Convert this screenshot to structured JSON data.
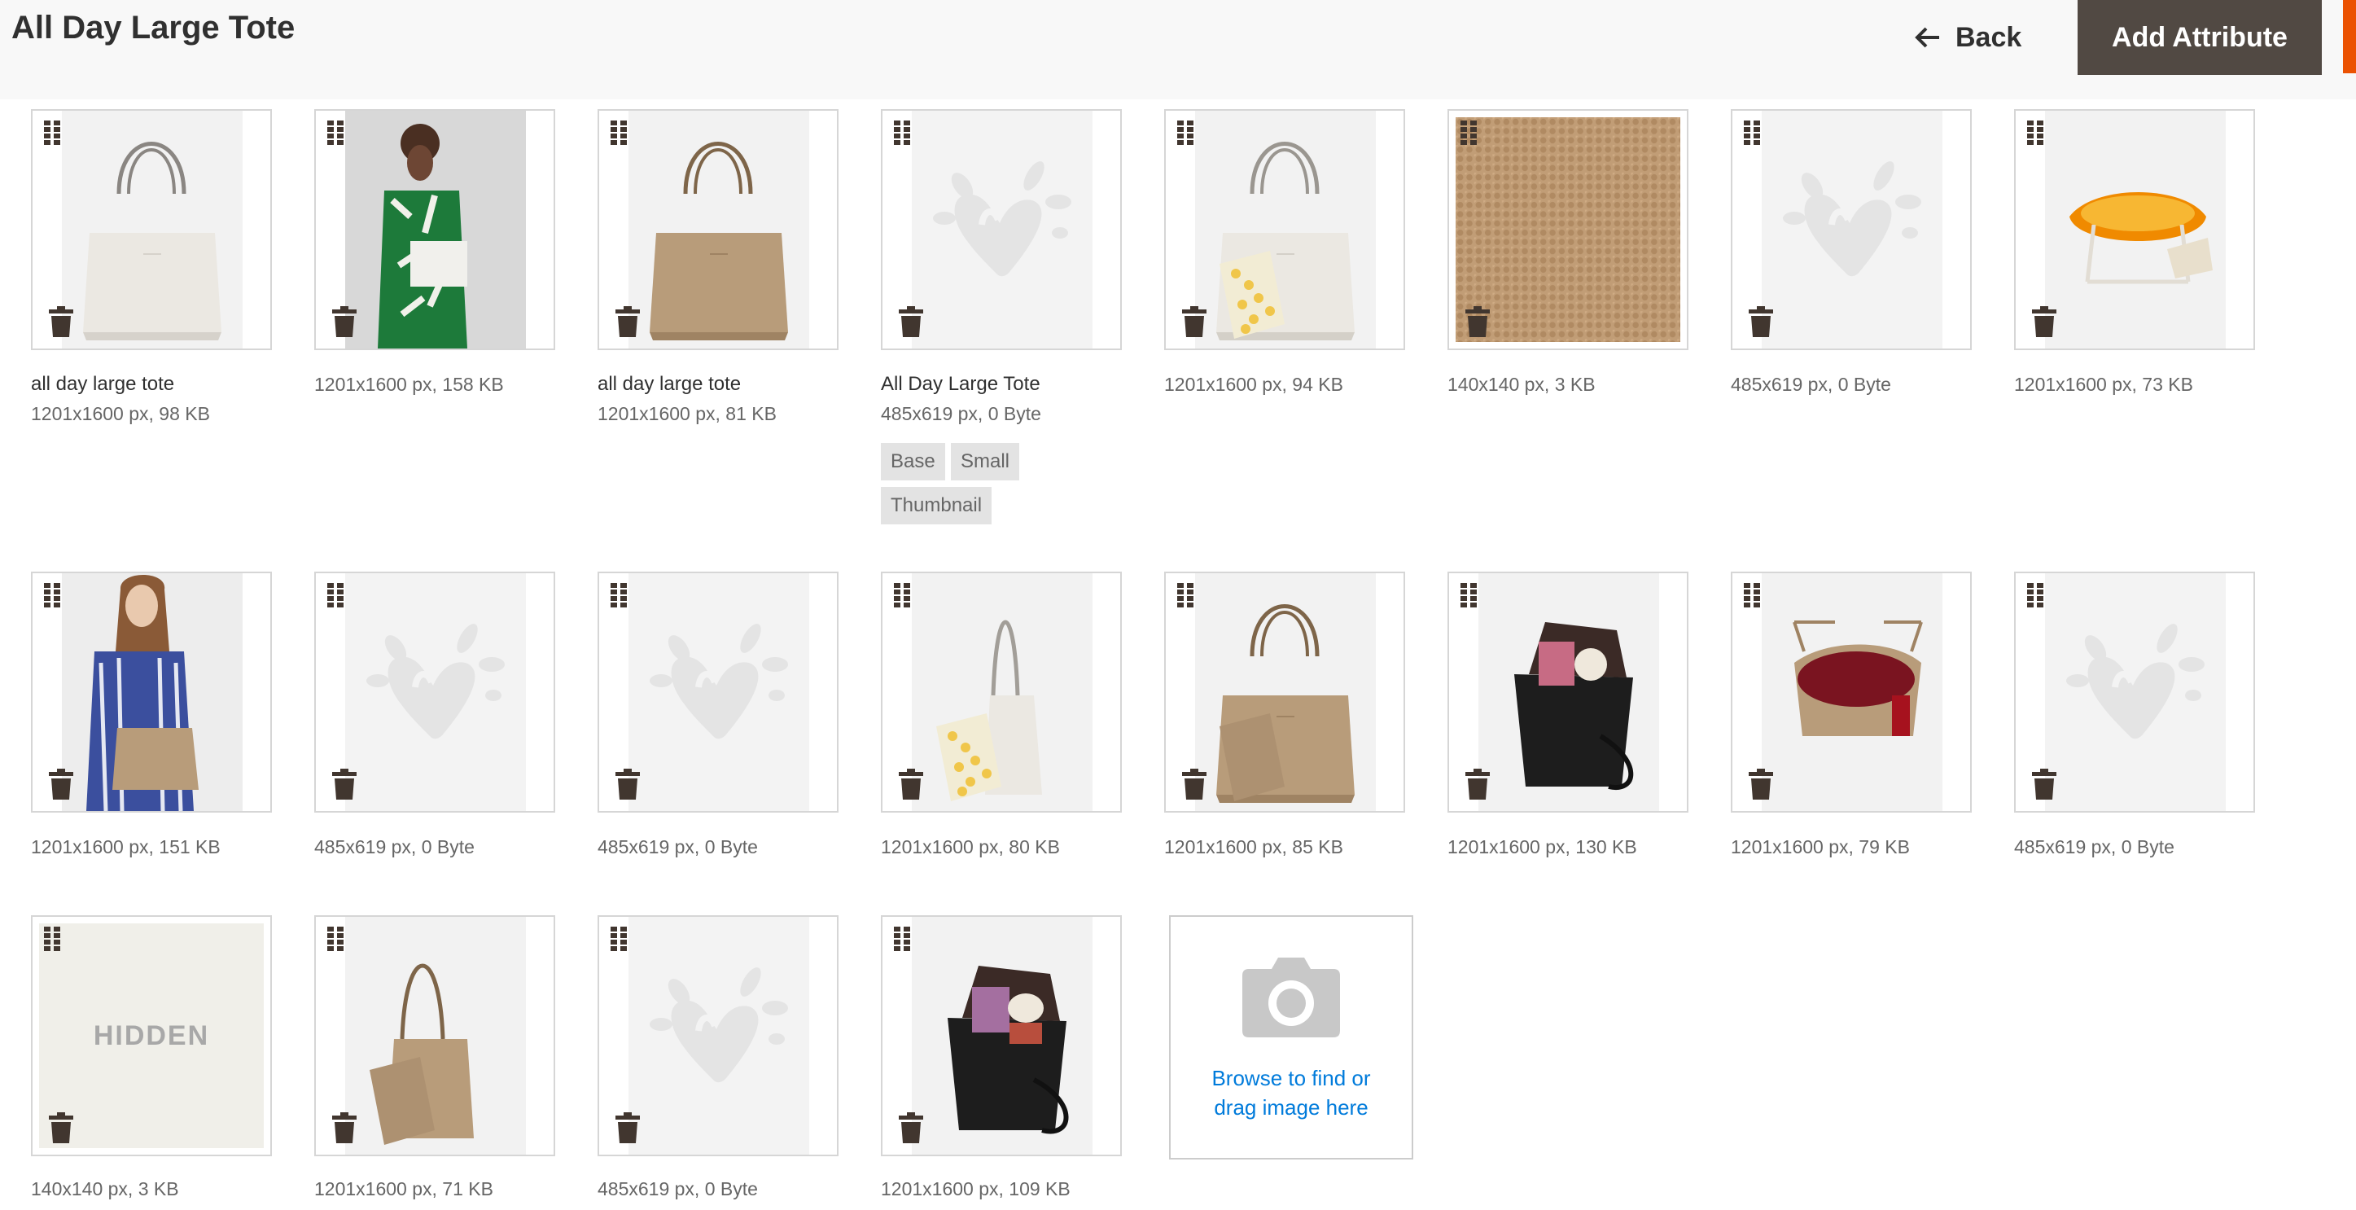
{
  "header": {
    "title": "All Day Large Tote",
    "back_label": "Back",
    "add_attribute_label": "Add Attribute"
  },
  "colors": {
    "accent": "#eb5202",
    "primary_button": "#514943",
    "link": "#007bdb"
  },
  "images": [
    {
      "caption": "all day large tote",
      "meta": "1201x1600 px, 98 KB",
      "thumb": "white-tote"
    },
    {
      "caption": "",
      "meta": "1201x1600 px, 158 KB",
      "thumb": "model-green-dress"
    },
    {
      "caption": "all day large tote",
      "meta": "1201x1600 px, 81 KB",
      "thumb": "tan-tote"
    },
    {
      "caption": "All Day Large Tote",
      "meta": "485x619 px, 0 Byte",
      "thumb": "placeholder",
      "roles": [
        "Base",
        "Small",
        "Thumbnail"
      ]
    },
    {
      "caption": "",
      "meta": "1201x1600 px, 94 KB",
      "thumb": "white-tote-pouch"
    },
    {
      "caption": "",
      "meta": "140x140 px, 3 KB",
      "thumb": "tan-leather-swatch"
    },
    {
      "caption": "",
      "meta": "485x619 px, 0 Byte",
      "thumb": "placeholder"
    },
    {
      "caption": "",
      "meta": "1201x1600 px, 73 KB",
      "thumb": "white-tote-open-orange"
    },
    {
      "caption": "",
      "meta": "1201x1600 px, 151 KB",
      "thumb": "model-blue-shirt"
    },
    {
      "caption": "",
      "meta": "485x619 px, 0 Byte",
      "thumb": "placeholder"
    },
    {
      "caption": "",
      "meta": "485x619 px, 0 Byte",
      "thumb": "placeholder"
    },
    {
      "caption": "",
      "meta": "1201x1600 px, 80 KB",
      "thumb": "white-tote-side-pouch"
    },
    {
      "caption": "",
      "meta": "1201x1600 px, 85 KB",
      "thumb": "tan-tote-pouch"
    },
    {
      "caption": "",
      "meta": "1201x1600 px, 130 KB",
      "thumb": "black-tote-open"
    },
    {
      "caption": "",
      "meta": "1201x1600 px, 79 KB",
      "thumb": "tan-tote-open-red"
    },
    {
      "caption": "",
      "meta": "485x619 px, 0 Byte",
      "thumb": "placeholder"
    },
    {
      "caption": "",
      "meta": "140x140 px, 3 KB",
      "thumb": "hidden-white-swatch",
      "overlay": "HIDDEN"
    },
    {
      "caption": "",
      "meta": "1201x1600 px, 71 KB",
      "thumb": "tan-tote-side-pouch"
    },
    {
      "caption": "",
      "meta": "485x619 px, 0 Byte",
      "thumb": "placeholder"
    },
    {
      "caption": "",
      "meta": "1201x1600 px, 109 KB",
      "thumb": "black-tote-open-items"
    }
  ],
  "upload": {
    "line1": "Browse to find or",
    "line2": "drag image here",
    "icon": "camera-icon"
  },
  "icons": {
    "drag": "drag-handle-icon",
    "delete": "trash-icon",
    "back": "arrow-left-icon",
    "placeholder": "brand-heart-placeholder"
  }
}
